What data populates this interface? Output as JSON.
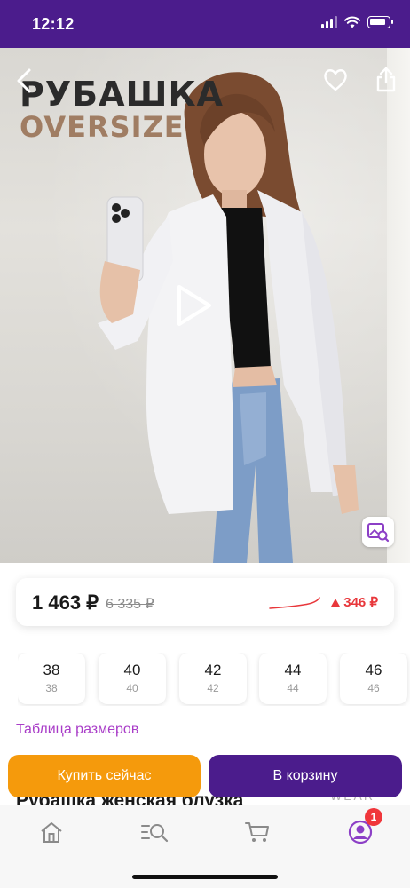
{
  "status_bar": {
    "time": "12:12"
  },
  "hero": {
    "title_line1": "РУБАШКА",
    "title_line2": "OVERSIZE"
  },
  "price": {
    "current": "1 463 ₽",
    "old": "6 335 ₽",
    "change": "346 ₽",
    "change_color": "#e8373b"
  },
  "sizes": [
    {
      "label": "38",
      "sub": "38"
    },
    {
      "label": "40",
      "sub": "40"
    },
    {
      "label": "42",
      "sub": "42"
    },
    {
      "label": "44",
      "sub": "44"
    },
    {
      "label": "46",
      "sub": "46"
    }
  ],
  "size_table_link": "Таблица размеров",
  "product_title": "Рубашка женская блузка",
  "brand_watermark": "WEAR",
  "actions": {
    "buy_now": "Купить сейчас",
    "add_to_cart": "В корзину"
  },
  "nav": {
    "items": [
      "home-icon",
      "catalog-search-icon",
      "cart-icon",
      "profile-icon"
    ],
    "profile_badge": "1"
  },
  "colors": {
    "brand_purple": "#4b1c8c",
    "buy_orange": "#f59a0c",
    "link_purple": "#a93dc8"
  }
}
